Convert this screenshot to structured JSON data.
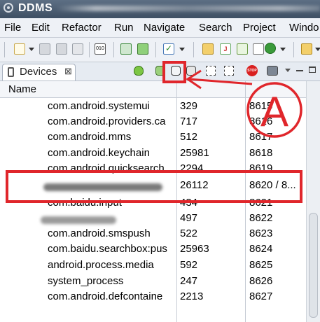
{
  "window": {
    "title": "DDMS"
  },
  "menu": [
    "File",
    "Edit",
    "Refactor",
    "Run",
    "Navigate",
    "Search",
    "Project",
    "Windo"
  ],
  "devices_view": {
    "tab_label": "Devices",
    "close_symbol": "⊠"
  },
  "table": {
    "header": {
      "name": "Name"
    },
    "rows": [
      {
        "name": "com.android.systemui",
        "pid": "329",
        "port": "8615"
      },
      {
        "name": "com.android.providers.ca",
        "pid": "717",
        "port": "8616"
      },
      {
        "name": "com.android.mms",
        "pid": "512",
        "port": "8617"
      },
      {
        "name": "com.android.keychain",
        "pid": "25981",
        "port": "8618"
      },
      {
        "name": "com.android.quicksearch",
        "pid": "2294",
        "port": "8619"
      },
      {
        "name": "",
        "pid": "26112",
        "port": "8620 / 8..."
      },
      {
        "name": "com.baidu.input",
        "pid": "434",
        "port": "8621"
      },
      {
        "name": "",
        "pid": "497",
        "port": "8622"
      },
      {
        "name": "com.android.smspush",
        "pid": "522",
        "port": "8623"
      },
      {
        "name": "com.baidu.searchbox:pus",
        "pid": "25963",
        "port": "8624"
      },
      {
        "name": "android.process.media",
        "pid": "592",
        "port": "8625"
      },
      {
        "name": "system_process",
        "pid": "247",
        "port": "8626"
      },
      {
        "name": "com.android.defcontaine",
        "pid": "2213",
        "port": "8627"
      }
    ]
  },
  "annotation": {
    "label": "A",
    "color": "#e0262b"
  },
  "colors": {
    "titlebar": "#4a5b70",
    "highlight_box": "#e0262b"
  }
}
